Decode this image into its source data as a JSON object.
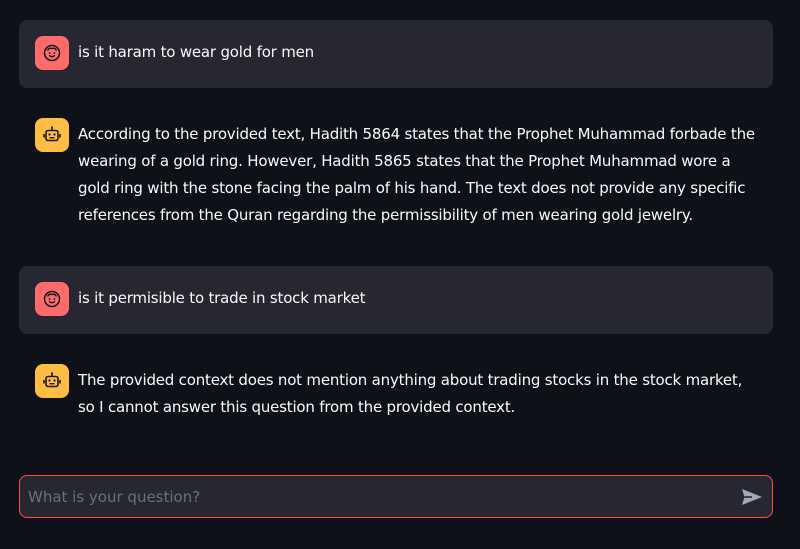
{
  "messages": [
    {
      "role": "user",
      "avatar_icon": "smiley-face-icon",
      "text": "is it haram to wear gold for men"
    },
    {
      "role": "assistant",
      "avatar_icon": "robot-icon",
      "text": "According to the provided text, Hadith 5864 states that the Prophet Muhammad forbade the wearing of a gold ring. However, Hadith 5865 states that the Prophet Muhammad wore a gold ring with the stone facing the palm of his hand. The text does not provide any specific references from the Quran regarding the permissibility of men wearing gold jewelry."
    },
    {
      "role": "user",
      "avatar_icon": "smiley-face-icon",
      "text": "is it permisible to trade in stock market"
    },
    {
      "role": "assistant",
      "avatar_icon": "robot-icon",
      "text": "The provided context does not mention anything about trading stocks in the stock market, so I cannot answer this question from the provided context."
    }
  ],
  "chat_input": {
    "placeholder": "What is your question?",
    "value": "",
    "send_icon": "send-icon"
  },
  "colors": {
    "background": "#0e1117",
    "user_bubble": "#262730",
    "user_avatar": "#ff6b6b",
    "assistant_avatar": "#ffbd45",
    "input_border": "#ff4b4b"
  }
}
